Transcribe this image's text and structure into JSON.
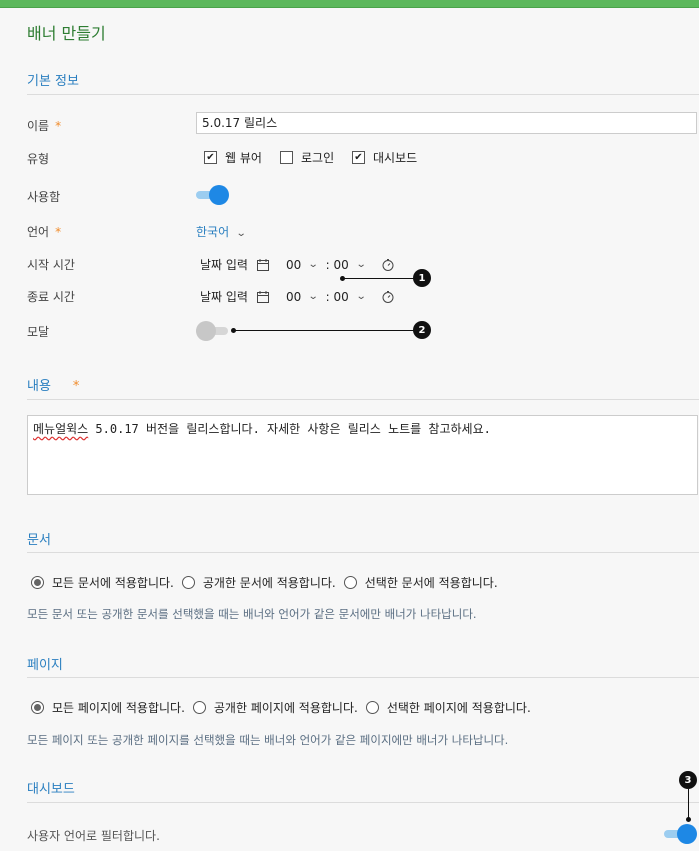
{
  "page_title": "배너 만들기",
  "colors": {
    "accent_green": "#5cb85c",
    "link_blue": "#2a7fc0",
    "required": "#f08c2c",
    "toggle_on": "#1e88e5"
  },
  "basic": {
    "section_title": "기본 정보",
    "name_label": "이름",
    "required_mark": "*",
    "name_value": "5.0.17 릴리스",
    "type_label": "유형",
    "types": [
      {
        "label": "웹 뷰어",
        "checked": true
      },
      {
        "label": "로그인",
        "checked": false
      },
      {
        "label": "대시보드",
        "checked": true
      }
    ],
    "enabled_label": "사용함",
    "enabled": true,
    "language_label": "언어",
    "language_value": "한국어",
    "start_label": "시작 시간",
    "end_label": "종료 시간",
    "date_placeholder": "날짜 입력",
    "hour": "00",
    "minute": ": 00",
    "modal_label": "모달",
    "modal": false
  },
  "content": {
    "section_title": "내용",
    "required_mark": "*",
    "text_first_word": "메뉴얼윅스",
    "text_rest": " 5.0.17 버전을 릴리스합니다. 자세한 사항은 릴리스 노트를 참고하세요."
  },
  "documents": {
    "section_title": "문서",
    "options": [
      "모든 문서에 적용합니다.",
      "공개한 문서에 적용합니다.",
      "선택한 문서에 적용합니다."
    ],
    "selected": 0,
    "hint": "모든 문서 또는 공개한 문서를 선택했을 때는 배너와 언어가 같은 문서에만 배너가 나타납니다."
  },
  "pages": {
    "section_title": "페이지",
    "options": [
      "모든 페이지에 적용합니다.",
      "공개한 페이지에 적용합니다.",
      "선택한 페이지에 적용합니다."
    ],
    "selected": 0,
    "hint": "모든 페이지 또는 공개한 페이지를 선택했을 때는 배너와 언어가 같은 페이지에만 배너가 나타납니다."
  },
  "dashboard": {
    "section_title": "대시보드",
    "filter_label": "사용자 언어로 필터합니다.",
    "filter_enabled": true
  },
  "callouts": [
    "1",
    "2",
    "3"
  ]
}
